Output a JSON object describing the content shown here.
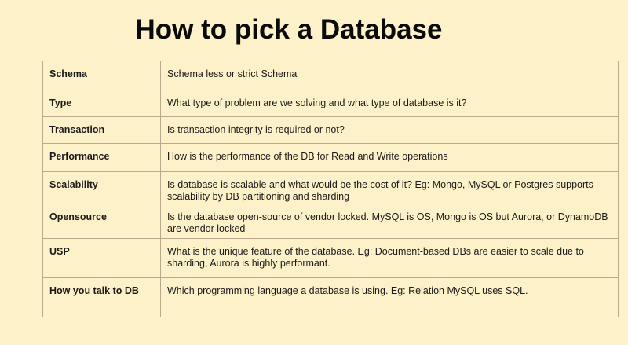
{
  "title": "How to pick a Database",
  "rows": [
    {
      "label": "Schema",
      "description": "Schema less or strict Schema"
    },
    {
      "label": "Type",
      "description": "What type of problem are we solving and what type of database is it?"
    },
    {
      "label": "Transaction",
      "description": "Is transaction integrity is required or not?"
    },
    {
      "label": "Performance",
      "description": "How is the performance of the DB for Read and Write operations"
    },
    {
      "label": "Scalability",
      "description": "Is database is scalable and what would be the cost of it? Eg: Mongo, MySQL or Postgres supports scalability by DB partitioning and sharding"
    },
    {
      "label": "Opensource",
      "description": "Is the database open-source of vendor locked. MySQL is OS, Mongo is OS but Aurora, or DynamoDB are vendor locked"
    },
    {
      "label": "USP",
      "description": "What is the unique feature of the database. Eg: Document-based DBs are easier to scale due to sharding, Aurora is highly performant."
    },
    {
      "label": "How you talk to DB",
      "description": "Which programming language a database is using. Eg: Relation MySQL uses SQL."
    }
  ]
}
